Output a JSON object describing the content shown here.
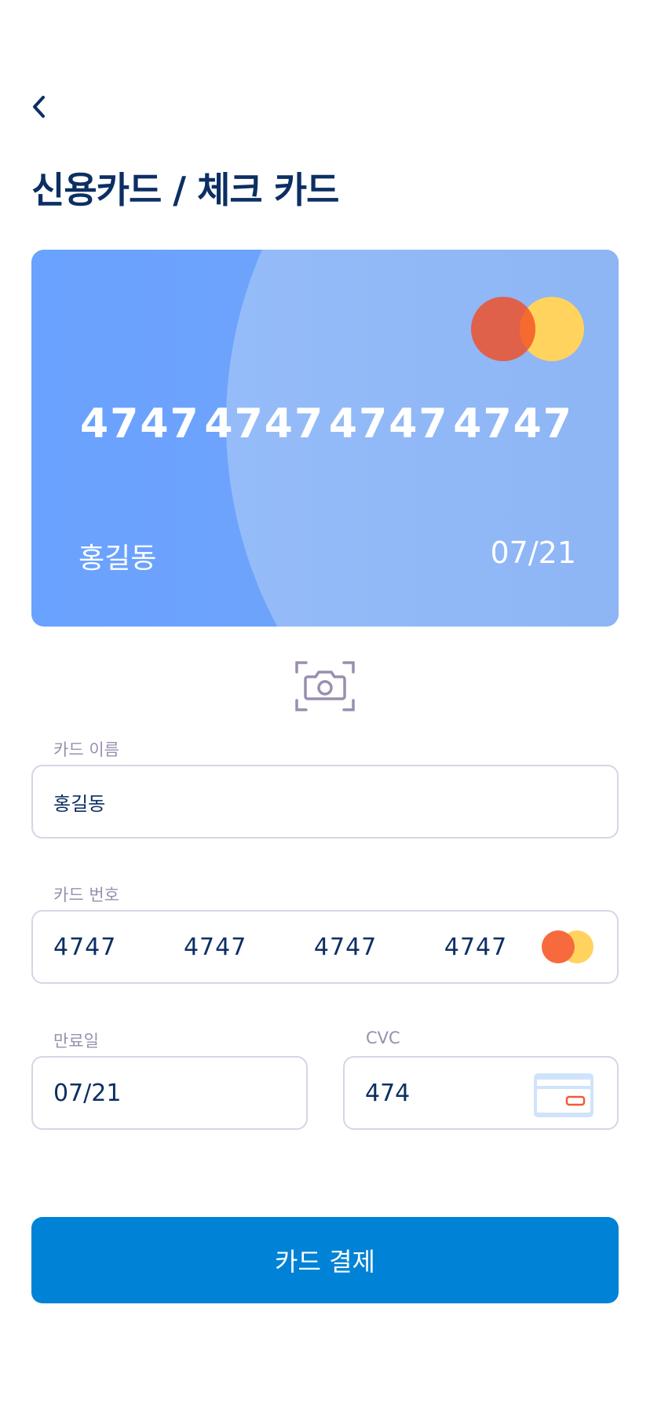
{
  "header": {
    "back_icon": "chevron-left-icon",
    "title": "신용카드 / 체크 카드"
  },
  "card_preview": {
    "brand_icon": "mastercard-logo-icon",
    "number_groups": [
      "4747",
      "4747",
      "4747",
      "4747"
    ],
    "holder_name": "홍길동",
    "expiry": "07/21",
    "colors": {
      "card_bg": "#69a2ff",
      "arc": "#95bcf9",
      "mc_red": "#e0614a",
      "mc_yellow": "#ffd35e",
      "mc_overlap": "#f76a2f"
    }
  },
  "scan": {
    "icon": "camera-scan-icon"
  },
  "form": {
    "name": {
      "label": "카드 이름",
      "value": "홍길동"
    },
    "number": {
      "label": "카드 번호",
      "value": "4747   4747   4747   4747",
      "brand_icon": "mastercard-logo-icon"
    },
    "expiry": {
      "label": "만료일",
      "value": "07/21"
    },
    "cvc": {
      "label": "CVC",
      "value": "474",
      "icon": "card-back-cvc-icon"
    }
  },
  "pay_button": {
    "label": "카드 결제",
    "color": "#0083d6"
  },
  "colors": {
    "title": "#0c2f63",
    "label": "#9a8fae",
    "field_border": "#d8d4e6"
  }
}
